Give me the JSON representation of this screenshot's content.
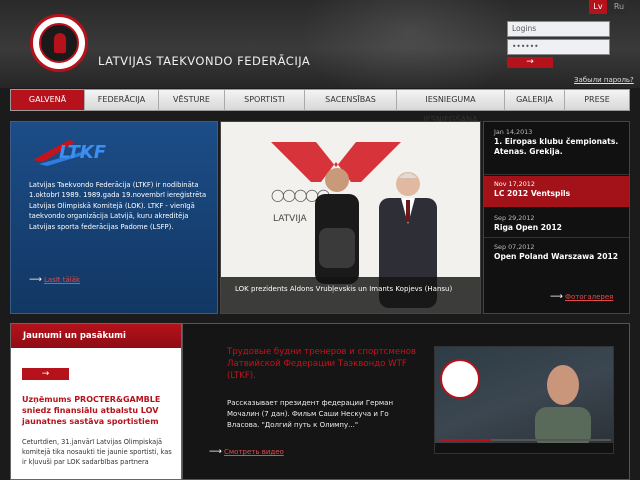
{
  "header": {
    "federation_title": "LATVIJAS TAEKVONDO FEDERĀCIJA",
    "languages": [
      "Lv",
      "Ru"
    ],
    "login": {
      "user_value": "Logins",
      "pass_value": "••••••",
      "submit_label": "→",
      "forgot_label": "Забыли пароль?"
    }
  },
  "nav": {
    "items": [
      {
        "label": "GALVENĀ",
        "active": true
      },
      {
        "label": "FEDERĀCIJA",
        "active": false
      },
      {
        "label": "VĒSTURE",
        "active": false
      },
      {
        "label": "SPORTISTI",
        "active": false
      },
      {
        "label": "SACENSĪBAS",
        "active": false
      },
      {
        "label": "IESNIEGUMA IESNIEGŠANA",
        "active": false
      },
      {
        "label": "GALERIJA",
        "active": false
      },
      {
        "label": "PRESE",
        "active": false
      }
    ]
  },
  "about": {
    "logo_text": "LTKF",
    "text": "Latvijas Taekvondo Federācija (LTKF) ir nodibināta 1.oktobrī 1989. 1989.gada 19.novembrī iereģistrēta Latvijas Olimpiskā Komitejā (LOK). LTKF - vienīgā taekvondo organizācija Latvijā, kuru akreditēja Latvijas sporta federācijas Padome (LSFP).",
    "more_label": "Lasīt tālāk"
  },
  "photo": {
    "backdrop_text": "LATVIJA",
    "caption": "LOK prezidents Aldons Vrubļevskis un Imants Kopjevs (Hansu)"
  },
  "events": {
    "items": [
      {
        "date": "Jan 14,2013",
        "name": "1. Eiropas klubu čempionats. Atenas. Grekija.",
        "active": false
      },
      {
        "date": "Nov 17,2012",
        "name": "LC 2012 Ventspils",
        "active": true
      },
      {
        "date": "Sep 29,2012",
        "name": "Riga Open 2012",
        "active": false
      },
      {
        "date": "Sep 07,2012",
        "name": "Open Poland Warszawa 2012",
        "active": false
      }
    ],
    "more_label": "Фотогалерея"
  },
  "news": {
    "heading": "Jaunumi un pasākumi",
    "button_label": "→",
    "title": "Uzņēmums PROCTER&GAMBLE sniedz finansiālu atbalstu LOV jaunatnes sastāva sportistiem",
    "body": "Ceturtdien, 31.janvārī Latvijas Olimpiskajā komitejā tika nosaukti tie jaunie sportisti, kas ir kļuvuši par LOK sadarbības partnera"
  },
  "video": {
    "title": "Трудовые будни тренеров и спортсменов Латвийской Федерации Таэквондо WTF (LTKF).",
    "description": "Рассказывает президент федерации Герман Мочалин (7 дан). Фильм Саши Нескуча и Го Власова. \"Долгий путь к Олимпу...\"",
    "more_label": "Смотреть видео",
    "progress": 0.3
  },
  "colors": {
    "accent": "#b5121b",
    "panel_blue": "#1c4d87"
  }
}
